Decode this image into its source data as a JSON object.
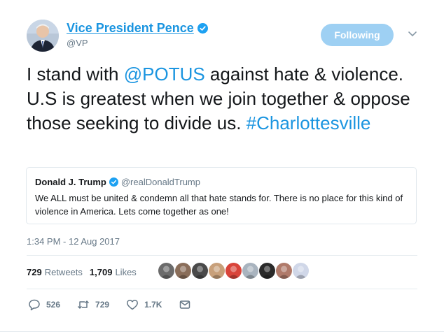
{
  "author": {
    "display_name": "Vice President Pence",
    "handle": "@VP",
    "verified_icon": "verified-badge-icon"
  },
  "follow_button": {
    "label": "Following"
  },
  "tweet": {
    "text_part1": "I stand with ",
    "mention": "@POTUS",
    "text_part2": " against hate & violence. U.S is greatest when we join together & oppose those seeking to divide us. ",
    "hashtag": "#Charlottesville"
  },
  "quoted_tweet": {
    "name": "Donald J. Trump",
    "handle": "@realDonaldTrump",
    "text": "We ALL must be united & condemn all that hate stands for. There is no place for this kind of violence in America. Lets come together as one!"
  },
  "timestamp": "1:34 PM - 12 Aug 2017",
  "stats": {
    "retweets_count": "729",
    "retweets_label": "Retweets",
    "likes_count": "1,709",
    "likes_label": "Likes"
  },
  "liker_avatars": [
    {
      "color": "#6b6b6b"
    },
    {
      "color": "#8a6e5a"
    },
    {
      "color": "#4a4a4a"
    },
    {
      "color": "#c8a07a"
    },
    {
      "color": "#d9443a"
    },
    {
      "color": "#a9b4bf"
    },
    {
      "color": "#2a2a2a"
    },
    {
      "color": "#b07a6a"
    },
    {
      "color": "#d0d7e8"
    }
  ],
  "actions": {
    "reply_count": "526",
    "retweet_count": "729",
    "like_count": "1.7K"
  },
  "colors": {
    "accent": "#1b95e0",
    "follow_button": "#9ed0f3",
    "muted_text": "#657786"
  }
}
